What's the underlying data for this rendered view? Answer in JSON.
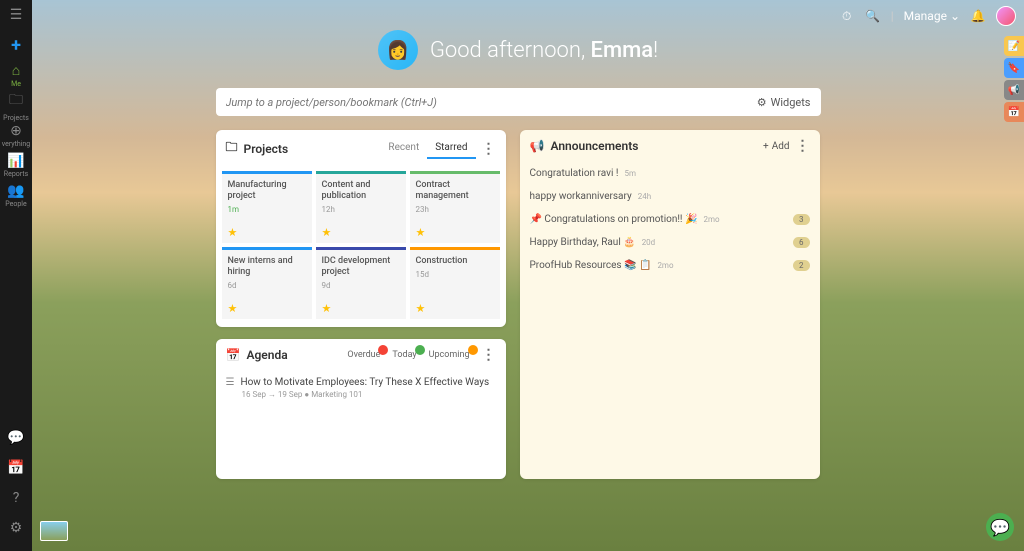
{
  "greeting": {
    "prefix": "Good afternoon, ",
    "name": "Emma",
    "suffix": "!"
  },
  "search": {
    "placeholder": "Jump to a project/person/bookmark (Ctrl+J)",
    "widgets_label": "Widgets"
  },
  "topbar": {
    "manage": "Manage"
  },
  "sidebar": {
    "items": [
      {
        "label": "Me"
      },
      {
        "label": "Projects"
      },
      {
        "label": "verything"
      },
      {
        "label": "Reports"
      },
      {
        "label": "People"
      }
    ]
  },
  "projects": {
    "title": "Projects",
    "tabs": {
      "recent": "Recent",
      "starred": "Starred"
    },
    "cards": [
      {
        "title": "Manufacturing project",
        "time": "1m",
        "color": "blue",
        "recent": true
      },
      {
        "title": "Content and publication",
        "time": "12h",
        "color": "teal"
      },
      {
        "title": "Contract management",
        "time": "23h",
        "color": "green"
      },
      {
        "title": "New interns and hiring",
        "time": "6d",
        "color": "blue"
      },
      {
        "title": "IDC development project",
        "time": "9d",
        "color": "nav"
      },
      {
        "title": "Construction",
        "time": "15d",
        "color": "orange"
      }
    ]
  },
  "announcements": {
    "title": "Announcements",
    "add": "Add",
    "items": [
      {
        "text": "Congratulation ravi !",
        "time": "5m"
      },
      {
        "text": "happy workanniversary",
        "time": "24h"
      },
      {
        "text": "📌 Congratulations on promotion!! 🎉",
        "time": "2mo",
        "badge": "3"
      },
      {
        "text": "Happy Birthday, Raul 🎂",
        "time": "20d",
        "badge": "6"
      },
      {
        "text": "ProofHub Resources 📚 📋",
        "time": "2mo",
        "badge": "2"
      }
    ]
  },
  "agenda": {
    "title": "Agenda",
    "tabs": {
      "overdue": "Overdue",
      "today": "Today",
      "upcoming": "Upcoming"
    },
    "task": {
      "title": "How to Motivate Employees: Try These X Effective Ways",
      "meta": "16 Sep → 19 Sep ● Marketing 101"
    }
  }
}
